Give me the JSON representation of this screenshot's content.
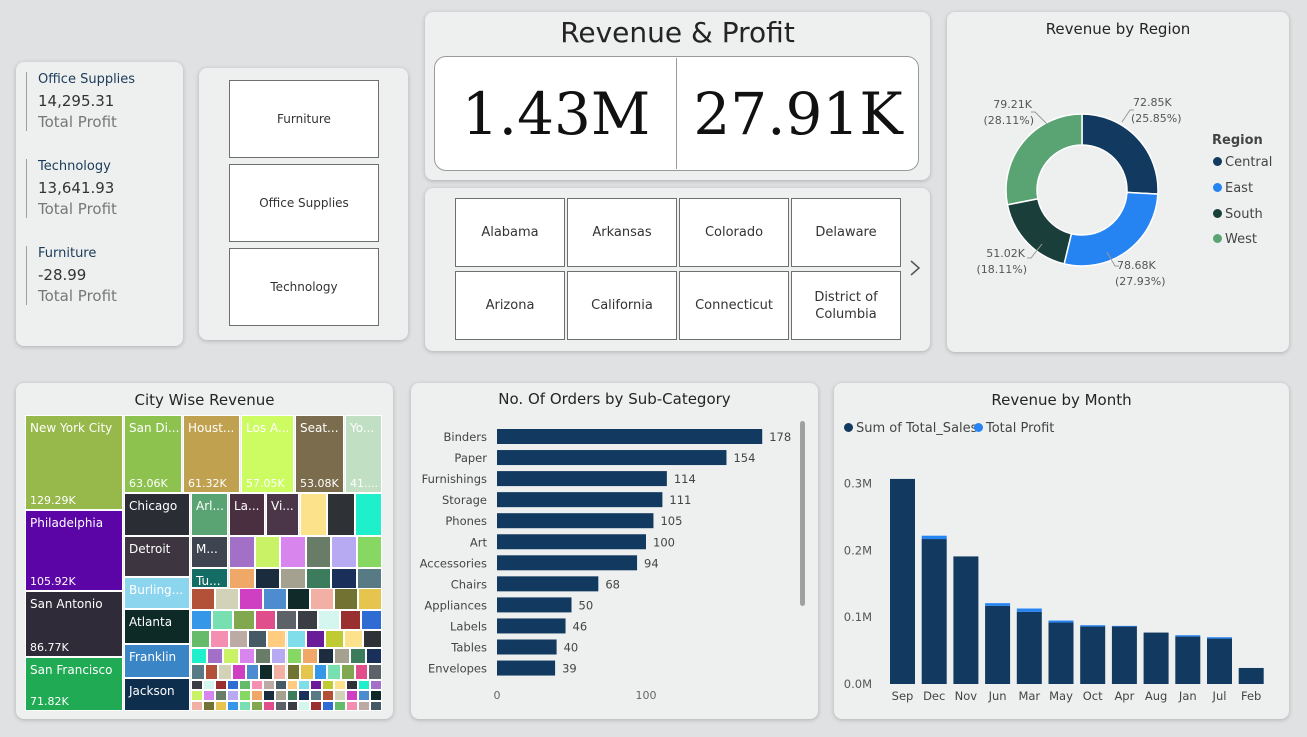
{
  "kpis": [
    {
      "name": "Office Supplies",
      "value": "14,295.31",
      "sub": "Total Profit"
    },
    {
      "name": "Technology",
      "value": "13,641.93",
      "sub": "Total Profit"
    },
    {
      "name": "Furniture",
      "value": "-28.99",
      "sub": "Total Profit"
    }
  ],
  "category_slicer": [
    "Furniture",
    "Office Supplies",
    "Technology"
  ],
  "revenue_profit": {
    "title": "Revenue & Profit",
    "revenue": "1.43M",
    "profit": "27.91K"
  },
  "state_slicer": {
    "row1": [
      "Alabama",
      "Arkansas",
      "Colorado",
      "Delaware"
    ],
    "row2": [
      "Arizona",
      "California",
      "Connecticut",
      "District of Columbia"
    ],
    "next_icon": "chevron-right-icon"
  },
  "region_chart": {
    "title": "Revenue by Region",
    "legend_title": "Region",
    "legend": [
      "Central",
      "East",
      "South",
      "West"
    ],
    "colors": {
      "Central": "#12395f",
      "East": "#2583f2",
      "South": "#1a3f3b",
      "West": "#5aa473"
    }
  },
  "city_treemap": {
    "title": "City Wise Revenue",
    "labeled": [
      {
        "name": "New York City",
        "value": "129.29K",
        "color": "#97b84a"
      },
      {
        "name": "Philadelphia",
        "value": "105.92K",
        "color": "#5c05a6"
      },
      {
        "name": "San Antonio",
        "value": "86.77K",
        "color": "#302b38"
      },
      {
        "name": "San Francisco",
        "value": "71.82K",
        "color": "#1faa53"
      },
      {
        "name": "San Di...",
        "value": "63.06K",
        "color": "#8ec24f"
      },
      {
        "name": "Houst...",
        "value": "61.32K",
        "color": "#c0a14f"
      },
      {
        "name": "Los A...",
        "value": "57.05K",
        "color": "#cdfb62"
      },
      {
        "name": "Seat...",
        "value": "53.08K",
        "color": "#7b6c4d"
      },
      {
        "name": "Yo...",
        "value": "41....",
        "color": "#c1dfc3"
      },
      {
        "name": "Chicago",
        "value": "",
        "color": "#2a2e34"
      },
      {
        "name": "Detroit",
        "value": "",
        "color": "#3d3640"
      },
      {
        "name": "Burling...",
        "value": "",
        "color": "#8cd5ef"
      },
      {
        "name": "Atlanta",
        "value": "",
        "color": "#0d2a26"
      },
      {
        "name": "Franklin",
        "value": "",
        "color": "#3a85c6"
      },
      {
        "name": "Jackson",
        "value": "",
        "color": "#0d2f4d"
      },
      {
        "name": "Arl...",
        "value": "",
        "color": "#5aa473"
      },
      {
        "name": "La...",
        "value": "",
        "color": "#492f40"
      },
      {
        "name": "Vi...",
        "value": "",
        "color": "#4a3648"
      },
      {
        "name": "M...",
        "value": "",
        "color": "#3e4450"
      },
      {
        "name": "Tu...",
        "value": "",
        "color": "#146d64"
      }
    ],
    "small_colors": [
      "#fce38b",
      "#2e3237",
      "#1ef0cb",
      "#a370c7",
      "#c9f267",
      "#d985ee",
      "#687c67",
      "#b7a9f2",
      "#86d862",
      "#efa867",
      "#1c2c3f",
      "#a5a190",
      "#3c7c5d",
      "#1a2f5a",
      "#587a84",
      "#b35138",
      "#d2d2b8",
      "#cf3fc2",
      "#4c8ccf",
      "#0f2a28",
      "#f2b0a5",
      "#727232",
      "#e6c54e",
      "#3497e8",
      "#78e0b0",
      "#82a84f",
      "#e04e8c",
      "#5d6269",
      "#3a3d44",
      "#d4f6ef",
      "#9a2f2f",
      "#2e6bd2",
      "#66bb6a",
      "#f48fb1",
      "#bcaaa4",
      "#455a64",
      "#ffcc80",
      "#80deea",
      "#6a1b9a",
      "#c0ca33"
    ]
  },
  "orders_chart": {
    "title": "No. Of Orders by Sub-Category",
    "xticks": [
      0,
      100
    ]
  },
  "month_chart": {
    "title": "Revenue by Month",
    "legend": [
      "Sum of Total_Sales",
      "Total Profit"
    ],
    "colors": {
      "sales": "#12395f",
      "profit": "#2583f2"
    },
    "yticks": [
      "0.0M",
      "0.1M",
      "0.2M",
      "0.3M"
    ]
  },
  "chart_data": [
    {
      "type": "pie",
      "title": "Revenue by Region",
      "categories": [
        "Central",
        "East",
        "South",
        "West"
      ],
      "values": [
        72.85,
        78.68,
        51.02,
        79.21
      ],
      "labels": [
        "72.85K",
        "78.68K",
        "51.02K",
        "79.21K"
      ],
      "percents": [
        "(25.85%)",
        "(27.93%)",
        "(18.11%)",
        "(28.11%)"
      ],
      "legend_position": "right"
    },
    {
      "type": "bar",
      "orientation": "horizontal",
      "title": "No. Of Orders by Sub-Category",
      "categories": [
        "Binders",
        "Paper",
        "Furnishings",
        "Storage",
        "Phones",
        "Art",
        "Accessories",
        "Chairs",
        "Appliances",
        "Labels",
        "Tables",
        "Envelopes"
      ],
      "values": [
        178,
        154,
        114,
        111,
        105,
        100,
        94,
        68,
        50,
        46,
        40,
        39
      ],
      "xlim": [
        0,
        180
      ]
    },
    {
      "type": "bar",
      "title": "Revenue by Month",
      "categories": [
        "Sep",
        "Dec",
        "Nov",
        "Jun",
        "Mar",
        "May",
        "Oct",
        "Apr",
        "Aug",
        "Jan",
        "Jul",
        "Feb"
      ],
      "series": [
        {
          "name": "Sum of Total_Sales",
          "values": [
            0.307,
            0.217,
            0.191,
            0.117,
            0.108,
            0.092,
            0.086,
            0.086,
            0.077,
            0.071,
            0.068,
            0.024
          ]
        },
        {
          "name": "Total Profit",
          "values": [
            0.0,
            0.005,
            0.0,
            0.004,
            0.005,
            0.003,
            0.002,
            0.001,
            0.0,
            0.002,
            0.002,
            0.0
          ]
        }
      ],
      "stacked": true,
      "ylim": [
        0,
        0.33
      ],
      "legend_position": "top-left"
    },
    {
      "type": "heatmap",
      "title": "City Wise Revenue",
      "categories": [
        "New York City",
        "Philadelphia",
        "San Antonio",
        "San Francisco",
        "San Di...",
        "Houst...",
        "Los A...",
        "Seat...",
        "Yo..."
      ],
      "values": [
        129.29,
        105.92,
        86.77,
        71.82,
        63.06,
        61.32,
        57.05,
        53.08,
        41
      ]
    }
  ]
}
